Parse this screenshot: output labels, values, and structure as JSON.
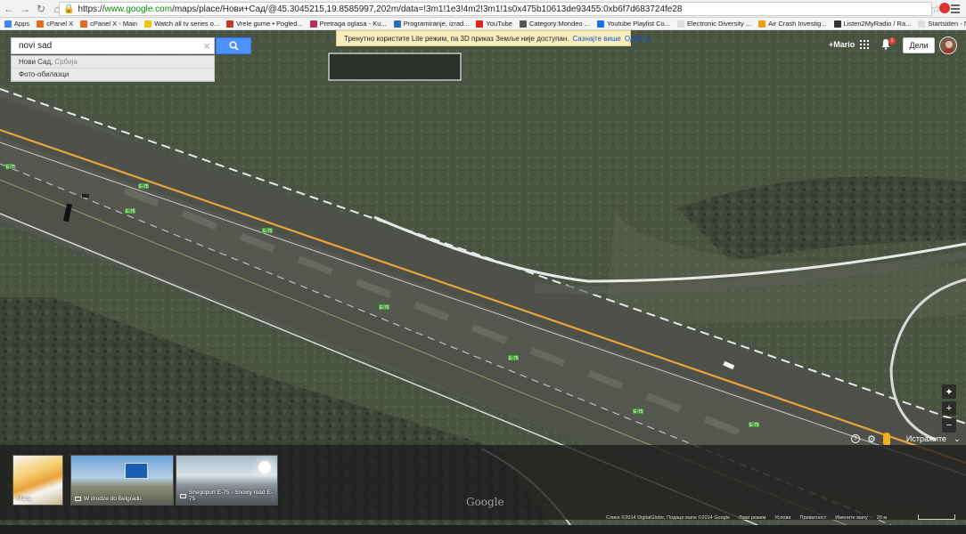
{
  "browser": {
    "url_prefix": "https://",
    "url_host": "www.google.com",
    "url_rest": "/maps/place/Нови+Сад/@45.3045215,19.8585997,202m/data=!3m1!1e3!4m2!3m1!1s0x475b10613de93455:0xb6f7d683724fe28",
    "bookmarks": [
      {
        "label": "Apps",
        "color": "#4285f4"
      },
      {
        "label": "cPanel X",
        "color": "#e66b1e"
      },
      {
        "label": "cPanel X - Main",
        "color": "#e66b1e"
      },
      {
        "label": "Watch all tv series o...",
        "color": "#f1c40f"
      },
      {
        "label": "Vrele gume • Pogled...",
        "color": "#c0392b"
      },
      {
        "label": "Pretraga oglasa - Ku...",
        "color": "#b03060"
      },
      {
        "label": "Programiranje, izrad...",
        "color": "#2a6ebb"
      },
      {
        "label": "YouTube",
        "color": "#e62117"
      },
      {
        "label": "Category:Mondeo ...",
        "color": "#555555"
      },
      {
        "label": "Youtube Playlist Co...",
        "color": "#1a73e8"
      },
      {
        "label": "Electronic Diversity ...",
        "color": "#dddddd"
      },
      {
        "label": "Air Crash Investig...",
        "color": "#f39c12"
      },
      {
        "label": "Listen2MyRadio / Ra...",
        "color": "#333333"
      },
      {
        "label": "Startsiden - NOKUT",
        "color": "#dddddd"
      }
    ]
  },
  "search": {
    "value": "novi sad",
    "suggestions": [
      {
        "main": "Нови Сад,",
        "muted": "Србија"
      },
      {
        "main": "Фото-обилазци",
        "muted": ""
      }
    ]
  },
  "lite_banner": {
    "text": "Тренутно користите Lite режим, па 3D приказ Земље није доступан.",
    "learn_more": "Сазнајте више",
    "dismiss": "Одбаци"
  },
  "header": {
    "user": "+Mario",
    "notifications": "1",
    "share": "Дели"
  },
  "map": {
    "road_label": "E-75",
    "explore": "Истражите",
    "google_logo": "Google"
  },
  "photos": [
    {
      "caption": "Mana",
      "has_camera": false
    },
    {
      "caption": "W drodze do Belgradu",
      "has_camera": true
    },
    {
      "caption": "Snegopurt E-75 - Snowy road E-75",
      "has_camera": true
    }
  ],
  "footer": {
    "items": [
      "Слике ©2014 DigitalGlobe, Подаци мапе ©2014 Google",
      "Лаки режим",
      "Услови",
      "Приватност",
      "Имените мапу",
      "20 м"
    ]
  },
  "colors": {
    "accent": "#4d90fe",
    "banner": "#f9edbe",
    "road_line": "#e8a33b"
  }
}
